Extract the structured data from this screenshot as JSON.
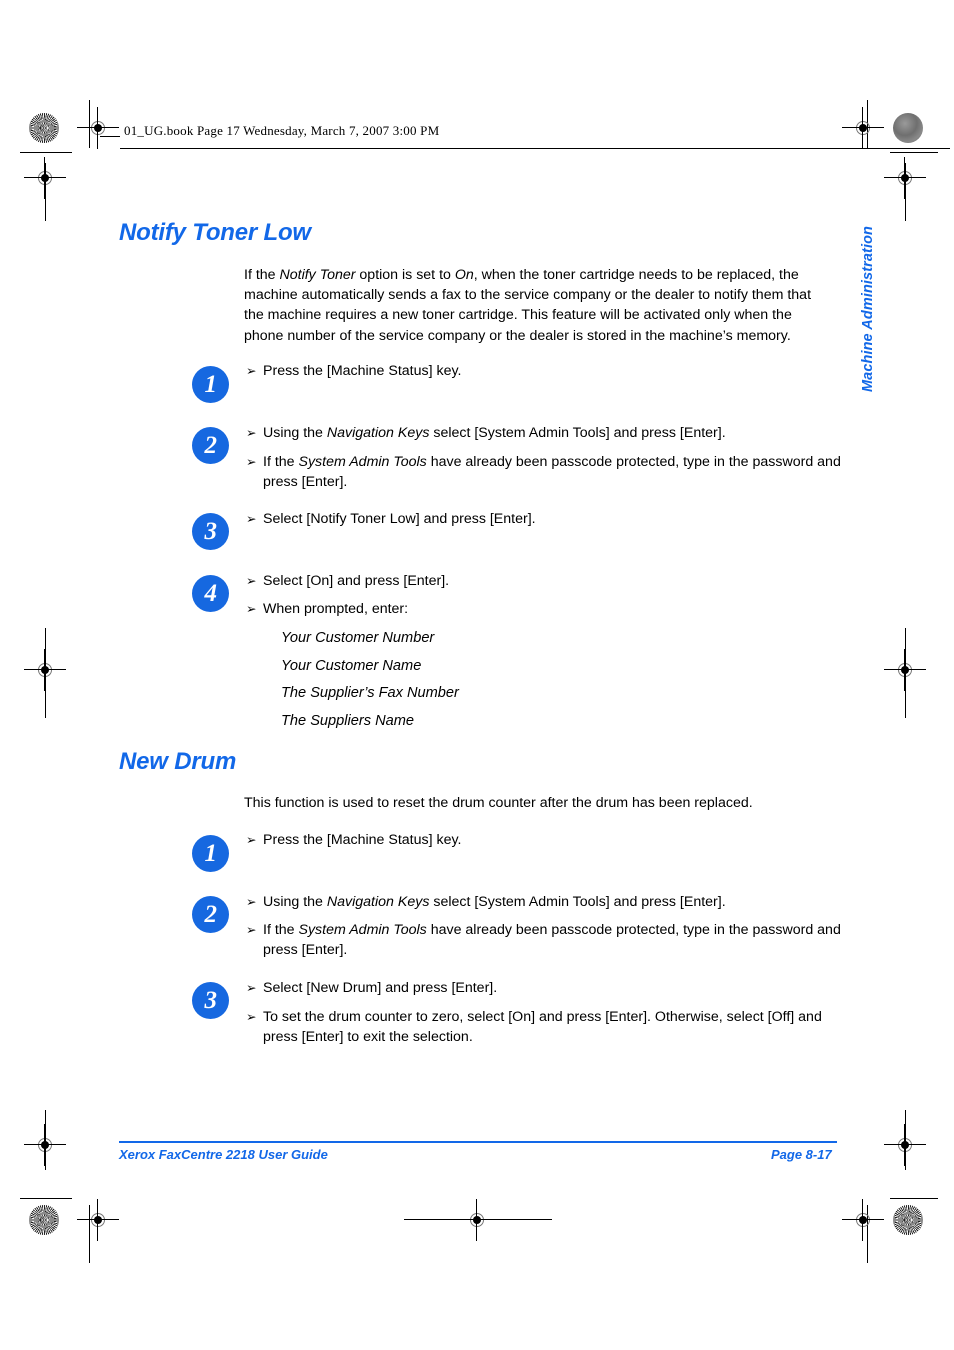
{
  "page": {
    "header_line": "01_UG.book  Page 17  Wednesday, March 7, 2007  3:00 PM",
    "side_tab": "Machine Administration",
    "footer_left": "Xerox FaxCentre 2218 User Guide",
    "footer_right": "Page 8-17",
    "accent_color": "#1268e8",
    "step_circle_color": "#1668e0",
    "bullet_glyph": "➢"
  },
  "sections": [
    {
      "title": "Notify Toner Low",
      "intro": {
        "part1": "If the ",
        "em1": "Notify Toner",
        "part2": " option is set to ",
        "em2": "On",
        "part3": ", when the toner cartridge needs to be replaced, the machine automatically sends a fax to the service company or the dealer to notify them that the machine requires a new toner cartridge. This feature will be activated only when the phone number of the service company or the dealer is stored in the machine’s memory."
      },
      "steps": [
        {
          "number": "1",
          "bullets": [
            {
              "text": "Press the [Machine Status] key."
            }
          ]
        },
        {
          "number": "2",
          "bullets": [
            {
              "pre": "Using the ",
              "em": "Navigation Keys",
              "post": " select [System Admin Tools] and press [Enter]."
            },
            {
              "pre": "If the ",
              "em": "System Admin Tools",
              "post": " have already been passcode protected, type in the password and press [Enter]."
            }
          ]
        },
        {
          "number": "3",
          "bullets": [
            {
              "text": "Select [Notify Toner Low] and press [Enter]."
            }
          ]
        },
        {
          "number": "4",
          "bullets": [
            {
              "text": "Select [On] and press [Enter]."
            },
            {
              "text": "When prompted, enter:"
            }
          ]
        }
      ],
      "italic_list": [
        "Your Customer Number",
        "Your Customer Name",
        "The Supplier’s Fax Number",
        "The Suppliers Name"
      ]
    },
    {
      "title": "New Drum",
      "intro_plain": "This function is used to reset the drum counter after the drum has been replaced.",
      "steps": [
        {
          "number": "1",
          "bullets": [
            {
              "text": "Press the [Machine Status] key."
            }
          ]
        },
        {
          "number": "2",
          "bullets": [
            {
              "pre": "Using the ",
              "em": "Navigation Keys",
              "post": " select [System Admin Tools] and press [Enter]."
            },
            {
              "pre": "If the ",
              "em": "System Admin Tools",
              "post": " have already been passcode protected, type in the password and press [Enter]."
            }
          ]
        },
        {
          "number": "3",
          "bullets": [
            {
              "text": "Select [New Drum] and press [Enter]."
            },
            {
              "text": "To set the drum counter to zero, select [On] and press [Enter]. Otherwise, select [Off] and press [Enter] to exit the selection."
            }
          ]
        }
      ]
    }
  ]
}
